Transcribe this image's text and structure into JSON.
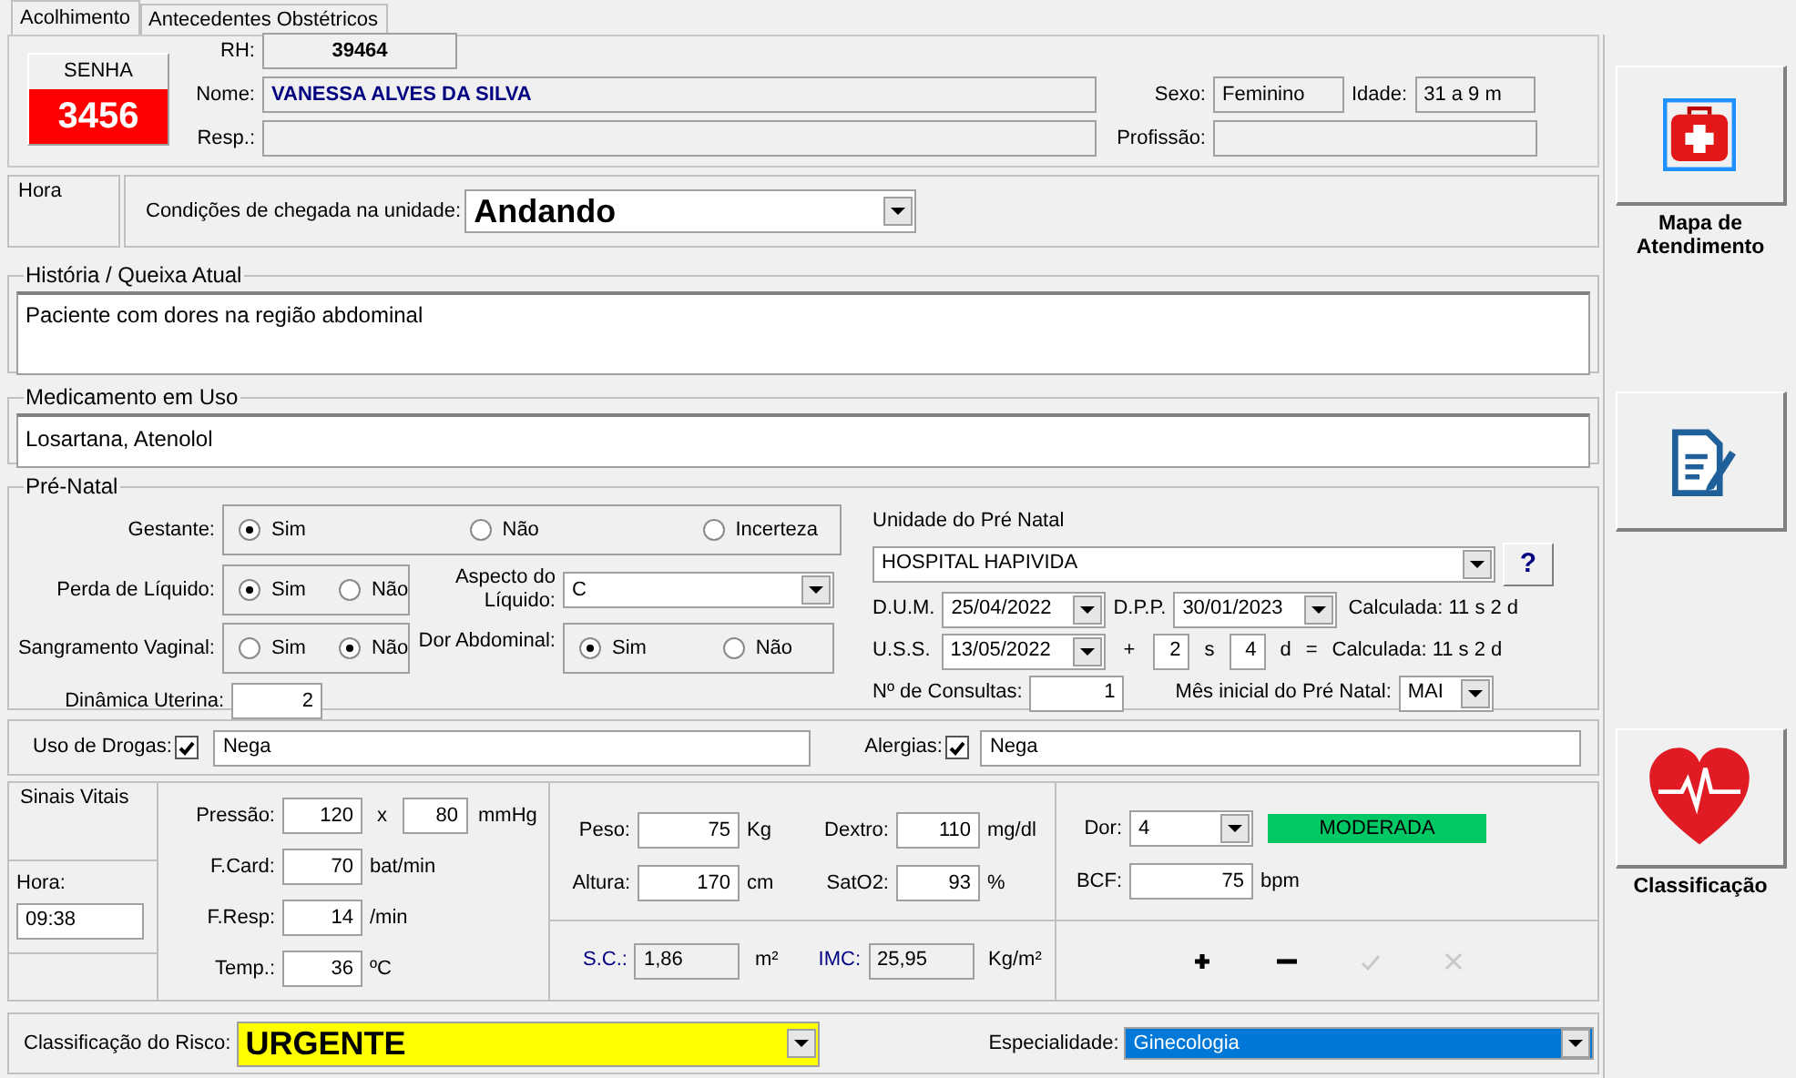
{
  "tabs": [
    {
      "label": "Acolhimento",
      "selected": true
    },
    {
      "label": "Antecedentes Obstétricos",
      "selected": false
    }
  ],
  "patient": {
    "senha_label": "SENHA",
    "senha": "3456",
    "rh_label": "RH:",
    "rh": "39464",
    "nome_label": "Nome:",
    "nome": "VANESSA  ALVES DA SILVA",
    "sexo_label": "Sexo:",
    "sexo": "Feminino",
    "idade_label": "Idade:",
    "idade": "31 a 9 m",
    "resp_label": "Resp.:",
    "profissao_label": "Profissão:"
  },
  "arrival": {
    "group_label": "Hora",
    "label": "Condições de chegada na unidade:",
    "value": "Andando"
  },
  "historia": {
    "legend": "História / Queixa Atual",
    "value": "Paciente com dores na região abdominal"
  },
  "medicamento": {
    "legend": "Medicamento em Uso",
    "value": "Losartana, Atenolol"
  },
  "prenatal": {
    "legend": "Pré-Natal",
    "gestante": {
      "label": "Gestante:",
      "options": [
        {
          "label": "Sim",
          "selected": true
        },
        {
          "label": "Não",
          "selected": false
        },
        {
          "label": "Incerteza",
          "selected": false
        }
      ]
    },
    "perda": {
      "label": "Perda de Líquido:",
      "options": [
        {
          "label": "Sim",
          "selected": true
        },
        {
          "label": "Não",
          "selected": false
        }
      ]
    },
    "aspecto": {
      "label": "Aspecto do Líquido:",
      "value": "C"
    },
    "sangramento": {
      "label": "Sangramento Vaginal:",
      "options": [
        {
          "label": "Sim",
          "selected": false
        },
        {
          "label": "Não",
          "selected": true
        }
      ]
    },
    "dor_abdominal": {
      "label": "Dor Abdominal:",
      "options": [
        {
          "label": "Sim",
          "selected": true
        },
        {
          "label": "Não",
          "selected": false
        }
      ]
    },
    "dinamica": {
      "label": "Dinâmica Uterina:",
      "value": "2"
    },
    "unidade": {
      "label": "Unidade do Pré Natal",
      "value": "HOSPITAL HAPIVIDA",
      "help": "?"
    },
    "dum": {
      "label": "D.U.M.",
      "value": "25/04/2022"
    },
    "dpp": {
      "label": "D.P.P.",
      "value": "30/01/2023"
    },
    "dum_calc": "Calculada: 11 s 2 d",
    "uss": {
      "label": "U.S.S.",
      "value": "13/05/2022",
      "plus": "+",
      "weeks": "2",
      "weeks_unit": "s",
      "days": "4",
      "days_unit": "d",
      "equals": "=",
      "calc": "Calculada: 11 s 2 d"
    },
    "consultas": {
      "label": "Nº de Consultas:",
      "value": "1"
    },
    "mes_inicial": {
      "label": "Mês inicial do Pré Natal:",
      "value": "MAI"
    }
  },
  "drogas": {
    "label": "Uso de Drogas:",
    "checked": true,
    "value": "Nega"
  },
  "alergias": {
    "label": "Alergias:",
    "checked": true,
    "value": "Nega"
  },
  "vitais": {
    "legend": "Sinais Vitais",
    "hora_label": "Hora:",
    "hora": "09:38",
    "pressao": {
      "label": "Pressão:",
      "sys": "120",
      "sep": "x",
      "dia": "80",
      "unit": "mmHg"
    },
    "rows": [
      {
        "label": "F.Card:",
        "value": "70",
        "unit": "bat/min"
      },
      {
        "label": "F.Resp:",
        "value": "14",
        "unit": "/min"
      },
      {
        "label": "Temp.:",
        "value": "36",
        "unit": "ºC"
      }
    ],
    "measures": [
      {
        "label": "Peso:",
        "value": "75",
        "unit": "Kg"
      },
      {
        "label": "Dextro:",
        "value": "110",
        "unit": "mg/dl"
      },
      {
        "label": "Altura:",
        "value": "170",
        "unit": "cm"
      },
      {
        "label": "SatO2:",
        "value": "93",
        "unit": "%"
      }
    ],
    "computed": [
      {
        "label": "S.C.:",
        "value": "1,86",
        "unit": "m²"
      },
      {
        "label": "IMC:",
        "value": "25,95",
        "unit": "Kg/m²"
      }
    ],
    "dor": {
      "label": "Dor:",
      "value": "4",
      "level_text": "MODERADA"
    },
    "bcf": {
      "label": "BCF:",
      "value": "75",
      "unit": "bpm"
    },
    "actions": [
      {
        "kind": "add",
        "disabled": false
      },
      {
        "kind": "remove",
        "disabled": false
      },
      {
        "kind": "confirm",
        "disabled": true
      },
      {
        "kind": "cancel",
        "disabled": true
      }
    ]
  },
  "risco": {
    "label": "Classificação do Risco:",
    "value": "URGENTE"
  },
  "especialidade": {
    "label": "Especialidade:",
    "value": "Ginecologia"
  },
  "side_buttons": [
    {
      "kind": "map",
      "label": "Mapa de Atendimento"
    },
    {
      "kind": "edit"
    },
    {
      "kind": "classification",
      "label": "Classificação"
    }
  ]
}
